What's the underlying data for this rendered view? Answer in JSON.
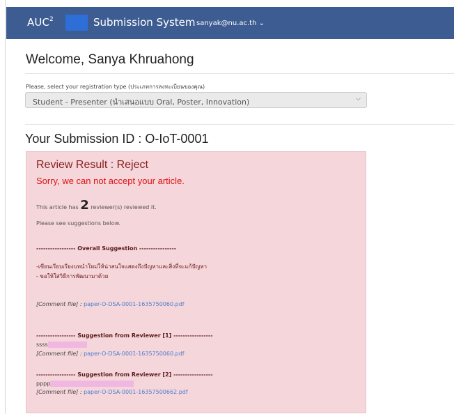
{
  "navbar": {
    "brand": "AUC",
    "brand_sup": "2",
    "system": "Submission System",
    "user": "sanyak@nu.ac.th ⌄"
  },
  "welcome": "Welcome, Sanya Khruahong",
  "registration": {
    "label": "Please, select your registration type (ประเภทการลงทะเบียนของคุณ)",
    "selected": "Student - Presenter (นำเสนอแบบ Oral, Poster, Innovation)"
  },
  "submission_id": "Your Submission ID : O-IoT-0001",
  "review": {
    "title": "Review Result : Reject",
    "message": "Sorry, we can not accept your article.",
    "reviewers_prefix": "This article has",
    "reviewers_count": "2",
    "reviewers_suffix": "reviewer(s) reviewed it.",
    "see_suggestions": "Please see suggestions below.",
    "overall_header": "----------------- Overall Suggestion ----------------",
    "overall_line1": "-เขียนเรียบเรียงบทนำใหม่ให้น่าสนใจแสดงถึงปัญหาและสิ่งที่จะแก้ปัญหา",
    "overall_line2": "- ขอให้ใส่วิธีการพัฒนามาด้วย",
    "comment_label": "[Comment file] :",
    "overall_file": "paper-O-DSA-0001-1635750060.pdf",
    "reviewer1_header": "----------------- Suggestion from Reviewer [1] -----------------",
    "reviewer1_text": "ssss",
    "reviewer1_file": "paper-O-DSA-0001-1635750060.pdf",
    "reviewer2_header": "----------------- Suggestion from Reviewer [2] -----------------",
    "reviewer2_text": "pppp",
    "reviewer2_file": "paper-O-DSA-0001-16357500662.pdf"
  },
  "colors": {
    "navbar": "#3d5d92",
    "panel": "#f5d6da",
    "reject_title": "#8a2020",
    "error_text": "#e01212",
    "link": "#4a7fcf"
  }
}
